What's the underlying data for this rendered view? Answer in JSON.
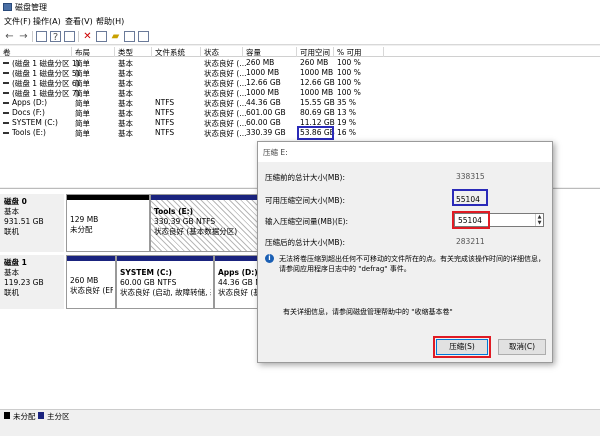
{
  "window": {
    "title": "磁盘管理"
  },
  "menu": [
    "文件(F)",
    "操作(A)",
    "查看(V)",
    "帮助(H)"
  ],
  "volume_table": {
    "columns": [
      "卷",
      "布局",
      "类型",
      "文件系统",
      "状态",
      "容量",
      "可用空间",
      "% 可用"
    ],
    "rows": [
      [
        "(磁盘 1 磁盘分区 1)",
        "简单",
        "基本",
        "",
        "状态良好 (...",
        "260 MB",
        "260 MB",
        "100 %"
      ],
      [
        "(磁盘 1 磁盘分区 5)",
        "简单",
        "基本",
        "",
        "状态良好 (...",
        "1000 MB",
        "1000 MB",
        "100 %"
      ],
      [
        "(磁盘 1 磁盘分区 6)",
        "简单",
        "基本",
        "",
        "状态良好 (...",
        "12.66 GB",
        "12.66 GB",
        "100 %"
      ],
      [
        "(磁盘 1 磁盘分区 7)",
        "简单",
        "基本",
        "",
        "状态良好 (...",
        "1000 MB",
        "1000 MB",
        "100 %"
      ],
      [
        "Apps (D:)",
        "简单",
        "基本",
        "NTFS",
        "状态良好 (...",
        "44.36 GB",
        "15.55 GB",
        "35 %"
      ],
      [
        "Docs (F:)",
        "简单",
        "基本",
        "NTFS",
        "状态良好 (...",
        "601.00 GB",
        "80.69 GB",
        "13 %"
      ],
      [
        "SYSTEM (C:)",
        "简单",
        "基本",
        "NTFS",
        "状态良好 (...",
        "60.00 GB",
        "11.12 GB",
        "19 %"
      ],
      [
        "Tools (E:)",
        "简单",
        "基本",
        "NTFS",
        "状态良好 (...",
        "330.39 GB",
        "53.86 GB",
        "16 %"
      ]
    ]
  },
  "disk0": {
    "name": "磁盘 0",
    "type": "基本",
    "size": "931.51 GB",
    "status": "联机",
    "partitions": [
      {
        "l1": "129 MB",
        "l2": "未分配",
        "l3": ""
      },
      {
        "l1": "Tools  (E:)",
        "l2": "330.39 GB NTFS",
        "l3": "状态良好 (基本数据分区)"
      }
    ]
  },
  "disk1": {
    "name": "磁盘 1",
    "type": "基本",
    "size": "119.23 GB",
    "status": "联机",
    "partitions": [
      {
        "l1": "",
        "l2": "260 MB",
        "l3": "状态良好 (EFI"
      },
      {
        "l1": "SYSTEM  (C:)",
        "l2": "60.00 GB NTFS",
        "l3": "状态良好 (启动, 故障转储, 基"
      },
      {
        "l1": "Apps  (D:)",
        "l2": "44.36 GB NTFS",
        "l3": "状态良好 (基"
      }
    ]
  },
  "legend": [
    "未分配",
    "主分区"
  ],
  "colors": {
    "unallocated": "#000000",
    "primary": "#1a237e",
    "highlight_blue": "#2a2ab8",
    "highlight_red": "#e01b24"
  },
  "dialog": {
    "title": "压缩 E:",
    "total_before_label": "压缩前的总计大小(MB):",
    "total_before_value": "338315",
    "available_label": "可用压缩空间大小(MB):",
    "available_value": "55104",
    "input_label": "输入压缩空间量(MB)(E):",
    "input_value": "55104",
    "total_after_label": "压缩后的总计大小(MB):",
    "total_after_value": "283211",
    "info_text": "无法将卷压缩到超出任何不可移动的文件所在的点。有关完成该操作时间的详细信息，请参阅应用程序日志中的 \"defrag\" 事件。",
    "more_info": "有关详细信息，请参阅磁盘管理帮助中的 \"收缩基本卷\"",
    "ok_label": "压缩(S)",
    "cancel_label": "取消(C)"
  }
}
